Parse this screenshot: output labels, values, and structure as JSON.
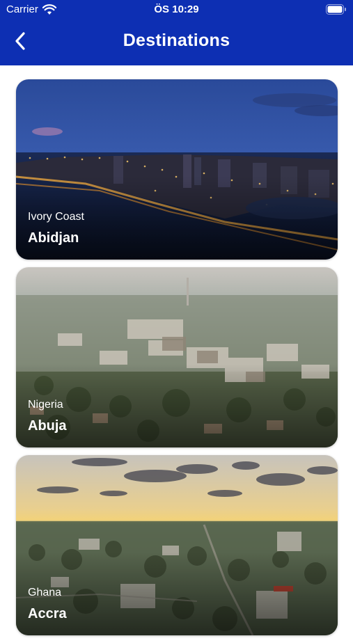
{
  "status_bar": {
    "carrier": "Carrier",
    "time": "ÖS 10:29",
    "wifi_icon": "wifi-icon",
    "battery_icon": "battery-icon"
  },
  "header": {
    "title": "Destinations",
    "back_icon": "chevron-left-icon",
    "background_color": "#0d2fb3"
  },
  "destinations": [
    {
      "country": "Ivory Coast",
      "city": "Abidjan"
    },
    {
      "country": "Nigeria",
      "city": "Abuja"
    },
    {
      "country": "Ghana",
      "city": "Accra"
    }
  ]
}
